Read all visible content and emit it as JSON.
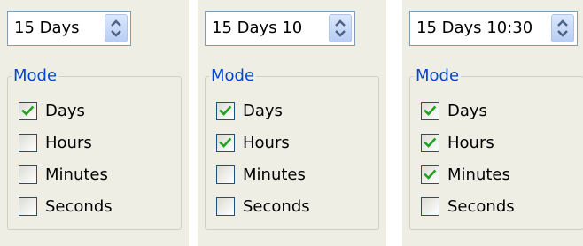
{
  "colors": {
    "panel_bg": "#eeeee5",
    "legend_text": "#0046d5",
    "check_mark": "#21a121",
    "checkbox_border": "#1c5180",
    "spin_border": "#7f9db9"
  },
  "panels": [
    {
      "spin_value": "15 Days",
      "mode_label": "Mode",
      "options": [
        {
          "label": "Days",
          "checked": true
        },
        {
          "label": "Hours",
          "checked": false
        },
        {
          "label": "Minutes",
          "checked": false
        },
        {
          "label": "Seconds",
          "checked": false
        }
      ]
    },
    {
      "spin_value": "15 Days 10",
      "mode_label": "Mode",
      "options": [
        {
          "label": "Days",
          "checked": true
        },
        {
          "label": "Hours",
          "checked": true
        },
        {
          "label": "Minutes",
          "checked": false
        },
        {
          "label": "Seconds",
          "checked": false
        }
      ]
    },
    {
      "spin_value": "15 Days 10:30",
      "mode_label": "Mode",
      "options": [
        {
          "label": "Days",
          "checked": true
        },
        {
          "label": "Hours",
          "checked": true
        },
        {
          "label": "Minutes",
          "checked": true
        },
        {
          "label": "Seconds",
          "checked": false
        }
      ]
    }
  ]
}
